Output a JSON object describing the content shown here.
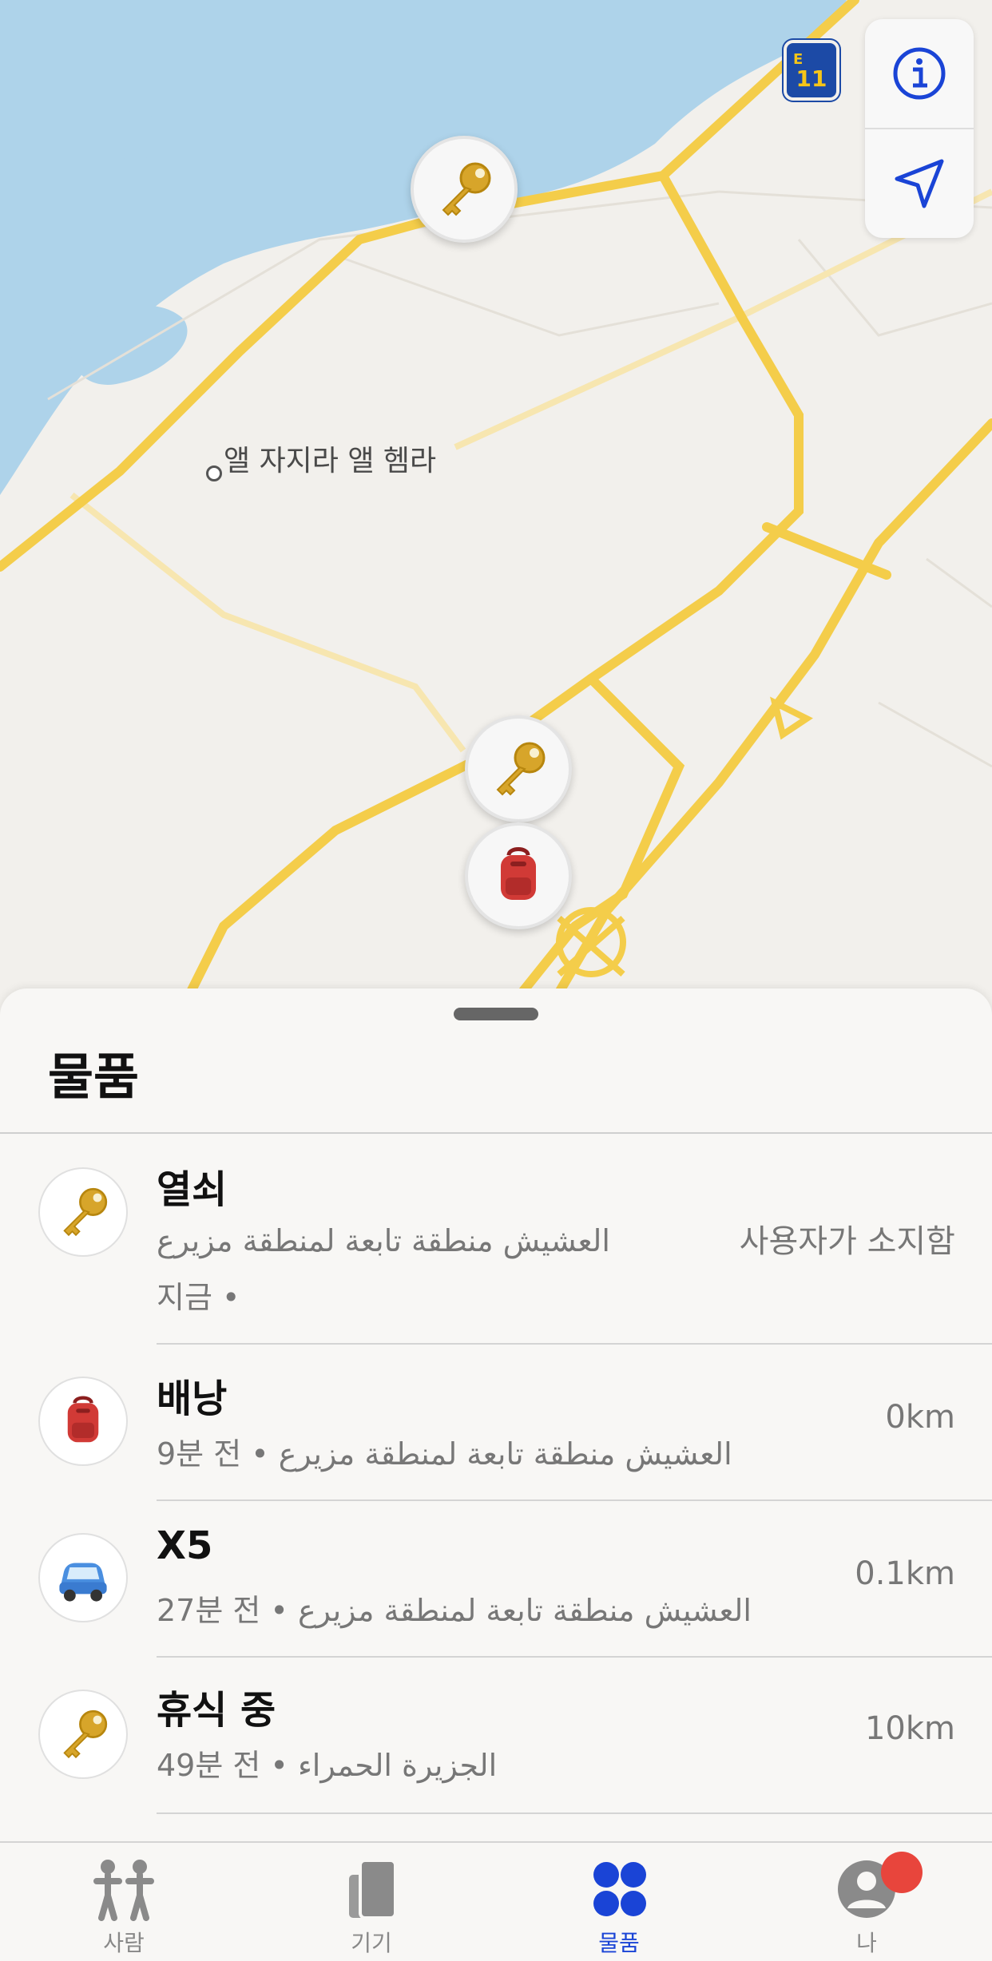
{
  "map": {
    "place_label": "앨 자지라 앨 헴라",
    "road_badge_letter": "E",
    "road_badge_number": "11",
    "info_button_icon": "info-circle-icon",
    "locate_button_icon": "location-arrow-icon",
    "pins": [
      "key",
      "key",
      "backpack"
    ]
  },
  "sheet": {
    "title": "물품",
    "items": [
      {
        "icon": "key",
        "name": "열쇠",
        "sub1": "العشيش منطقة تابعة لمنطقة مزيرع",
        "sub2": "지금 •",
        "right": "사용자가 소지함"
      },
      {
        "icon": "backpack",
        "name": "배낭",
        "sub1": "9분 전 • العشيش منطقة تابعة لمنطقة مزيرع",
        "right": "0km"
      },
      {
        "icon": "car",
        "name": "X5",
        "sub1": "27분 전 • العشيش منطقة تابعة لمنطقة مزيرع",
        "right": "0.1km"
      },
      {
        "icon": "key",
        "name": "휴식 중",
        "sub1": "49분 전 • الجزيرة الحمراء",
        "right": "10km"
      }
    ]
  },
  "tabbar": {
    "tabs": [
      {
        "label": "사람",
        "icon": "people-icon"
      },
      {
        "label": "기기",
        "icon": "devices-icon"
      },
      {
        "label": "물품",
        "icon": "items-icon",
        "active": true
      },
      {
        "label": "나",
        "icon": "profile-icon"
      }
    ]
  },
  "colors": {
    "accent": "#1a44d6",
    "water": "#aed3ea",
    "road": "#f4cd4a",
    "land": "#f2f0ec",
    "notification": "#e8453c"
  }
}
